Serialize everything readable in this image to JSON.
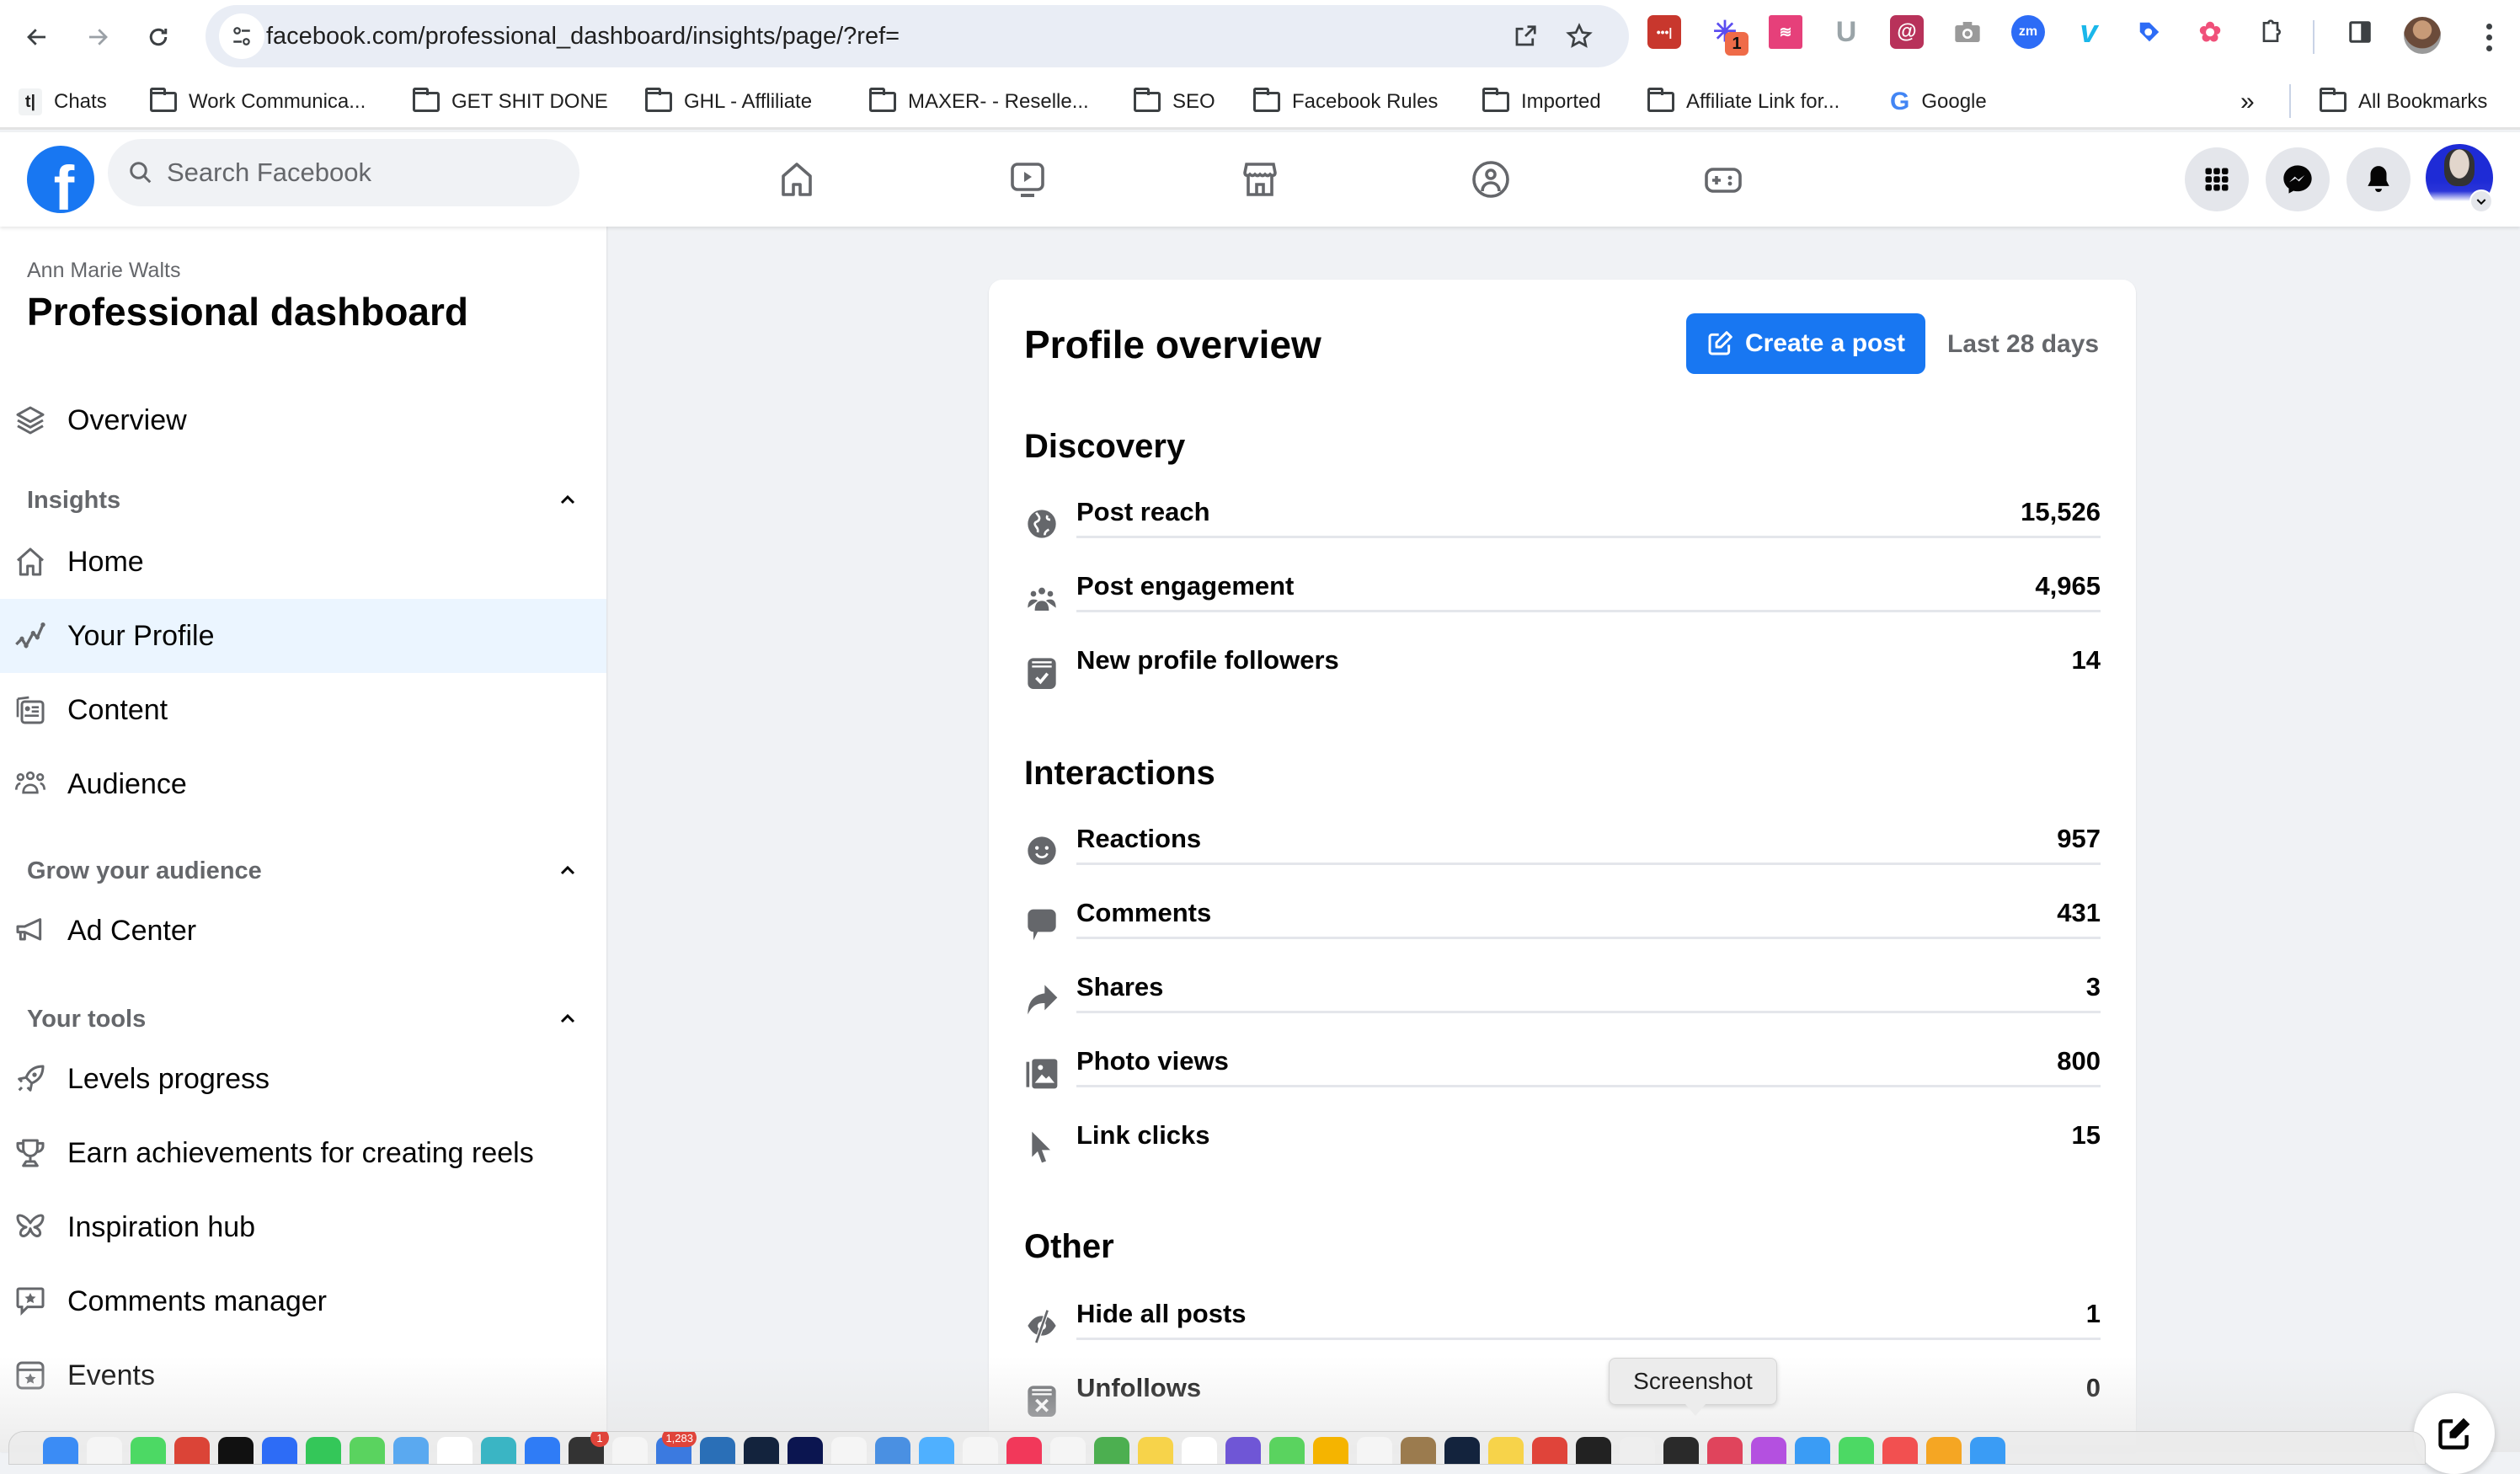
{
  "browser": {
    "url": "facebook.com/professional_dashboard/insights/page/?ref=",
    "extensions": [
      {
        "name": "lastpass-extension",
        "color": "#c8372d",
        "glyph": "•••|"
      },
      {
        "name": "asterisk-extension",
        "color": "#ffffff",
        "glyph": "✳",
        "badge": "1"
      },
      {
        "name": "flag-extension",
        "color": "#e6407a",
        "glyph": "⚑"
      },
      {
        "name": "u-extension",
        "color": "#ffffff",
        "glyph": "U"
      },
      {
        "name": "at-extension",
        "color": "#b8325a",
        "glyph": "@"
      },
      {
        "name": "camera-extension",
        "color": "#ffffff",
        "glyph": "📷"
      },
      {
        "name": "zoom-extension",
        "color": "#2d6cf6",
        "glyph": "zm"
      },
      {
        "name": "vimeo-extension",
        "color": "#ffffff",
        "glyph": "V"
      },
      {
        "name": "tag-extension",
        "color": "#ffffff",
        "glyph": "🏷"
      },
      {
        "name": "flower-extension",
        "color": "#ffffff",
        "glyph": "✿"
      }
    ],
    "bookmarks": [
      {
        "label": "Chats",
        "type": "app"
      },
      {
        "label": "Work Communica...",
        "type": "folder"
      },
      {
        "label": "GET SHIT DONE",
        "type": "folder"
      },
      {
        "label": "GHL - Affliliate",
        "type": "folder"
      },
      {
        "label": "MAXER- - Reselle...",
        "type": "folder"
      },
      {
        "label": "SEO",
        "type": "folder"
      },
      {
        "label": "Facebook Rules",
        "type": "folder"
      },
      {
        "label": "Imported",
        "type": "folder"
      },
      {
        "label": "Affiliate Link for...",
        "type": "folder"
      },
      {
        "label": "Google",
        "type": "google"
      }
    ],
    "overflow_label": "»",
    "all_bookmarks_label": "All Bookmarks"
  },
  "fb_header": {
    "search_placeholder": "Search Facebook",
    "logo_glyph": "f"
  },
  "sidebar": {
    "owner_name": "Ann Marie Walts",
    "title": "Professional dashboard",
    "overview_label": "Overview",
    "sections": [
      {
        "label": "Insights",
        "items": [
          "Home",
          "Your Profile",
          "Content",
          "Audience"
        ]
      },
      {
        "label": "Grow your audience",
        "items": [
          "Ad Center"
        ]
      },
      {
        "label": "Your tools",
        "items": [
          "Levels progress",
          "Earn achievements for creating reels",
          "Inspiration hub",
          "Comments manager",
          "Events"
        ]
      }
    ],
    "active_item": "Your Profile"
  },
  "main": {
    "title": "Profile overview",
    "create_post_label": "Create a post",
    "date_range": "Last 28 days",
    "sections": [
      {
        "title": "Discovery",
        "metrics": [
          {
            "label": "Post reach",
            "value": "15,526",
            "icon": "globe-icon"
          },
          {
            "label": "Post engagement",
            "value": "4,965",
            "icon": "people-icon"
          },
          {
            "label": "New profile followers",
            "value": "14",
            "icon": "follow-check-icon"
          }
        ]
      },
      {
        "title": "Interactions",
        "metrics": [
          {
            "label": "Reactions",
            "value": "957",
            "icon": "smile-icon"
          },
          {
            "label": "Comments",
            "value": "431",
            "icon": "comment-icon"
          },
          {
            "label": "Shares",
            "value": "3",
            "icon": "share-icon"
          },
          {
            "label": "Photo views",
            "value": "800",
            "icon": "photo-icon"
          },
          {
            "label": "Link clicks",
            "value": "15",
            "icon": "cursor-icon"
          }
        ]
      },
      {
        "title": "Other",
        "metrics": [
          {
            "label": "Hide all posts",
            "value": "1",
            "icon": "hidden-icon"
          },
          {
            "label": "Unfollows",
            "value": "0",
            "icon": "unfollow-icon"
          }
        ]
      }
    ]
  },
  "overlay": {
    "tooltip": "Screenshot",
    "dock_badges": [
      "1",
      "1,283"
    ]
  },
  "colors": {
    "fb_blue": "#1877f2",
    "active_bg": "#ebf5ff",
    "secondary_text": "#65676b",
    "page_bg": "#f0f2f5"
  }
}
